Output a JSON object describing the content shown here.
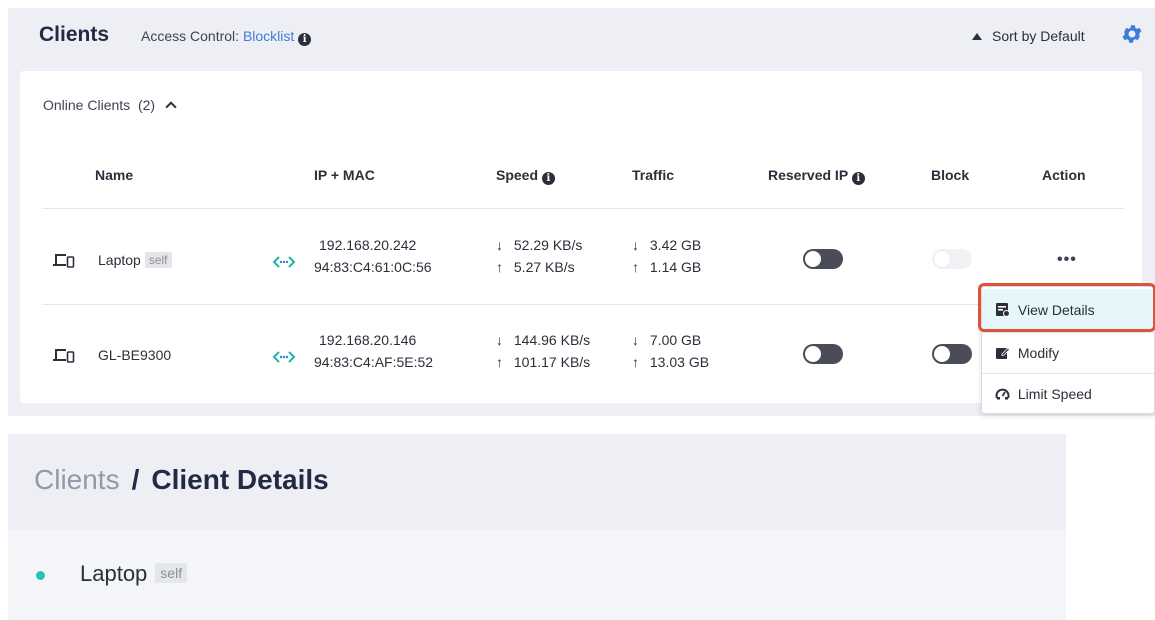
{
  "header": {
    "title": "Clients",
    "access_label": "Access Control: ",
    "access_value": "Blocklist",
    "sort_label": "Sort by Default"
  },
  "online": {
    "label": "Online Clients",
    "count": "(2)"
  },
  "columns": {
    "name": "Name",
    "ip_mac": "IP + MAC",
    "speed": "Speed",
    "traffic": "Traffic",
    "reserved_ip": "Reserved IP",
    "block": "Block",
    "action": "Action"
  },
  "clients": [
    {
      "name": "Laptop",
      "badge": "self",
      "ip": "192.168.20.242",
      "mac": "94:83:C4:61:0C:56",
      "speed_down": "52.29 KB/s",
      "speed_up": "5.27 KB/s",
      "traffic_down": "3.42 GB",
      "traffic_up": "1.14 GB",
      "reserved_ip": false,
      "block": false,
      "block_disabled": true,
      "action": "•••"
    },
    {
      "name": "GL-BE9300",
      "badge": "",
      "ip": "192.168.20.146",
      "mac": "94:83:C4:AF:5E:52",
      "speed_down": "144.96 KB/s",
      "speed_up": "101.17 KB/s",
      "traffic_down": "7.00 GB",
      "traffic_up": "13.03 GB",
      "reserved_ip": false,
      "block": false,
      "block_disabled": false,
      "action": ""
    }
  ],
  "action_menu": {
    "items": [
      {
        "label": "View Details",
        "icon": "details-icon",
        "highlighted": true
      },
      {
        "label": "Modify",
        "icon": "edit-icon"
      },
      {
        "label": "Limit Speed",
        "icon": "speedometer-icon"
      }
    ]
  },
  "details": {
    "breadcrumb_parent": "Clients",
    "breadcrumb_sep": "/",
    "breadcrumb_current": "Client Details",
    "client_name": "Laptop",
    "client_badge": "self",
    "status_color": "#25c3b0"
  },
  "colors": {
    "accent_link": "#3f7cd9",
    "highlight_border": "#e0523a",
    "gear": "#3f7cd9"
  }
}
